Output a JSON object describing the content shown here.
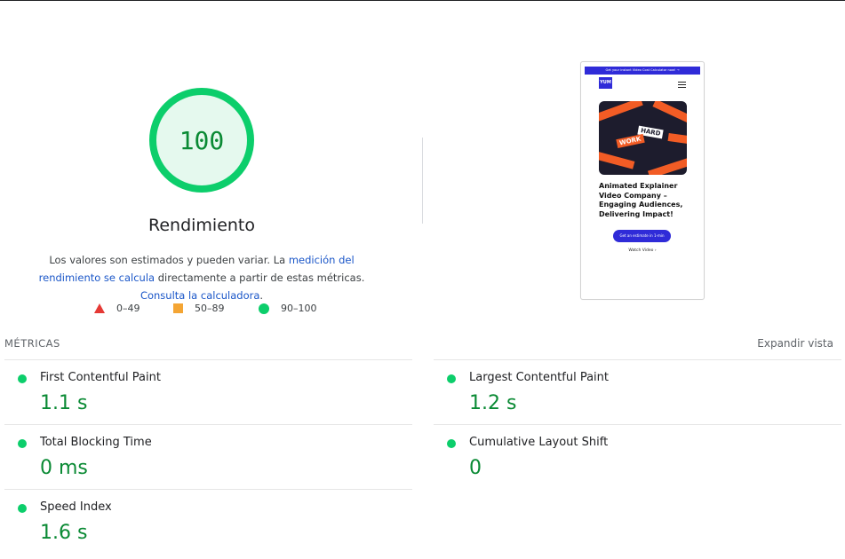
{
  "performance": {
    "score": "100",
    "label": "Rendimiento",
    "score_color": "#0cce6b",
    "description": {
      "text1": "Los valores son estimados y pueden variar. La ",
      "link1": "medición del rendimiento se calcula",
      "text2": " directamente a partir de estas métricas. ",
      "link2": "Consulta la calculadora",
      "text3": "."
    },
    "legend": [
      {
        "icon": "red-triangle-icon",
        "range": "0–49",
        "color": "#e53935"
      },
      {
        "icon": "orange-square-icon",
        "range": "50–89",
        "color": "#f4a534"
      },
      {
        "icon": "green-circle-icon",
        "range": "90–100",
        "color": "#0cce6b"
      }
    ]
  },
  "screenshot": {
    "banner": "Get your instant Video Cost Calculator now! →",
    "logo": "YUM",
    "hero_tags": [
      "HARD",
      "WORK"
    ],
    "headline": "Animated Explainer Video Company – Engaging Audiences, Delivering Impact!",
    "cta": "Get an estimate in 1-min",
    "watch": "Watch Video ›"
  },
  "metrics": {
    "title": "MÉTRICAS",
    "expand": "Expandir vista",
    "items": [
      {
        "name": "First Contentful Paint",
        "value": "1.1 s"
      },
      {
        "name": "Largest Contentful Paint",
        "value": "1.2 s"
      },
      {
        "name": "Total Blocking Time",
        "value": "0 ms"
      },
      {
        "name": "Cumulative Layout Shift",
        "value": "0"
      },
      {
        "name": "Speed Index",
        "value": "1.6 s"
      }
    ]
  }
}
